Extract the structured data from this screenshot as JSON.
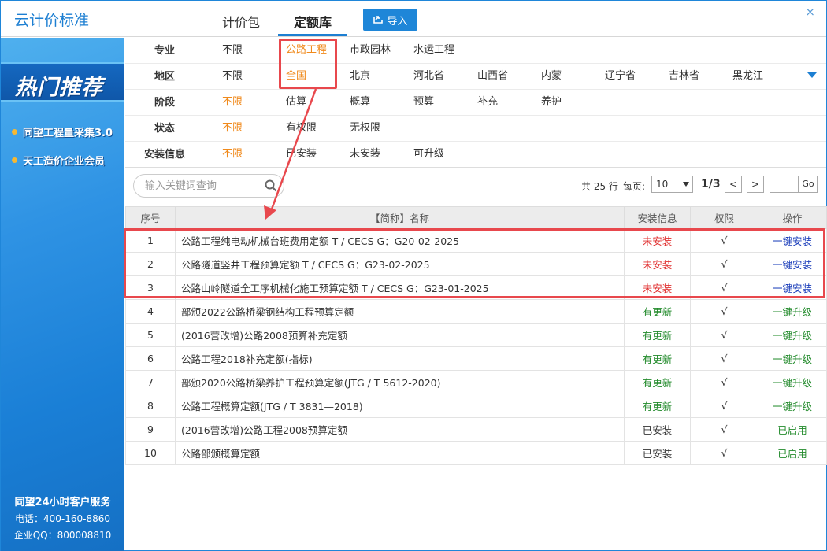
{
  "app": {
    "title": "云计价标准",
    "close_label": "×"
  },
  "tabs": [
    {
      "label": "计价包",
      "active": false
    },
    {
      "label": "定额库",
      "active": true
    }
  ],
  "toolbar": {
    "import_label": "导入"
  },
  "sidebar": {
    "hot_title": "热门推荐",
    "links": [
      {
        "label": "同望工程量采集3.0"
      },
      {
        "label": "天工造价企业会员"
      }
    ],
    "service": {
      "title": "同望24小时客户服务",
      "phone": "电话：400-160-8860",
      "qq": "企业QQ：800008810"
    }
  },
  "filters": [
    {
      "label": "专业",
      "options": [
        "不限",
        "公路工程",
        "市政园林",
        "水运工程"
      ],
      "selected": "公路工程"
    },
    {
      "label": "地区",
      "options": [
        "不限",
        "全国",
        "北京",
        "河北省",
        "山西省",
        "内蒙",
        "辽宁省",
        "吉林省",
        "黑龙江"
      ],
      "selected": "全国"
    },
    {
      "label": "阶段",
      "options": [
        "不限",
        "估算",
        "概算",
        "预算",
        "补充",
        "养护"
      ],
      "selected": "不限"
    },
    {
      "label": "状态",
      "options": [
        "不限",
        "有权限",
        "无权限"
      ],
      "selected": "不限"
    },
    {
      "label": "安装信息",
      "options": [
        "不限",
        "已安装",
        "未安装",
        "可升级"
      ],
      "selected": "不限"
    }
  ],
  "search": {
    "placeholder": "输入关键词查询",
    "value": ""
  },
  "pager": {
    "total_text": "共 25 行",
    "per_page_label": "每页:",
    "per_page_value": "10",
    "page_text": "1/3",
    "prev_label": "<",
    "next_label": ">",
    "go_label": "Go"
  },
  "table": {
    "headers": [
      "序号",
      "【简称】名称",
      "安装信息",
      "权限",
      "操作"
    ],
    "rows": [
      {
        "no": "1",
        "name": "公路工程纯电动机械台班费用定额 T / CECS G：G20-02-2025",
        "status": "未安装",
        "perm": "√",
        "action": "一键安装"
      },
      {
        "no": "2",
        "name": "公路隧道竖井工程预算定额 T / CECS G：G23-02-2025",
        "status": "未安装",
        "perm": "√",
        "action": "一键安装"
      },
      {
        "no": "3",
        "name": "公路山岭隧道全工序机械化施工预算定额 T / CECS G：G23-01-2025",
        "status": "未安装",
        "perm": "√",
        "action": "一键安装"
      },
      {
        "no": "4",
        "name": "部颁2022公路桥梁钢结构工程预算定额",
        "status": "有更新",
        "perm": "√",
        "action": "一键升级"
      },
      {
        "no": "5",
        "name": "(2016营改增)公路2008预算补充定额",
        "status": "有更新",
        "perm": "√",
        "action": "一键升级"
      },
      {
        "no": "6",
        "name": "公路工程2018补充定额(指标)",
        "status": "有更新",
        "perm": "√",
        "action": "一键升级"
      },
      {
        "no": "7",
        "name": "部颁2020公路桥梁养护工程预算定额(JTG / T 5612-2020)",
        "status": "有更新",
        "perm": "√",
        "action": "一键升级"
      },
      {
        "no": "8",
        "name": "公路工程概算定额(JTG / T 3831—2018)",
        "status": "有更新",
        "perm": "√",
        "action": "一键升级"
      },
      {
        "no": "9",
        "name": "(2016营改增)公路工程2008预算定额",
        "status": "已安装",
        "perm": "√",
        "action": "已启用"
      },
      {
        "no": "10",
        "name": "公路部颁概算定额",
        "status": "已安装",
        "perm": "√",
        "action": "已启用"
      }
    ]
  },
  "colors": {
    "accent": "#1d7fd2",
    "active_option": "#f08a1c",
    "highlight": "#e8484d",
    "not_installed": "#e02f2f",
    "update": "#238b2c",
    "install_action": "#1a3dba"
  }
}
